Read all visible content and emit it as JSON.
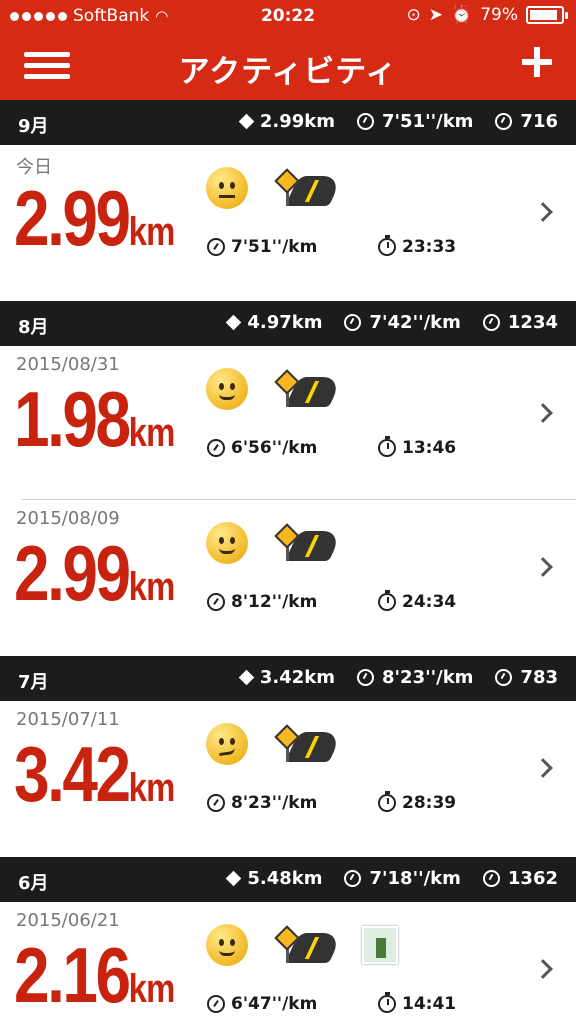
{
  "status_bar": {
    "carrier": "SoftBank",
    "time": "20:22",
    "battery": "79%",
    "battery_level": 0.79
  },
  "nav": {
    "title": "アクティビティ"
  },
  "months": [
    {
      "label": "9月",
      "distance": "2.99km",
      "pace": "7'51''/km",
      "fuel": "716"
    },
    {
      "label": "8月",
      "distance": "4.97km",
      "pace": "7'42''/km",
      "fuel": "1234"
    },
    {
      "label": "7月",
      "distance": "3.42km",
      "pace": "8'23''/km",
      "fuel": "783"
    },
    {
      "label": "6月",
      "distance": "5.48km",
      "pace": "7'18''/km",
      "fuel": "1362"
    }
  ],
  "activities": [
    {
      "date": "今日",
      "distance": "2.99",
      "unit": "km",
      "pace": "7'51''/km",
      "duration": "23:33",
      "mood": "neutral-face-icon"
    },
    {
      "date": "2015/08/31",
      "distance": "1.98",
      "unit": "km",
      "pace": "6'56''/km",
      "duration": "13:46",
      "mood": "smile-face-icon"
    },
    {
      "date": "2015/08/09",
      "distance": "2.99",
      "unit": "km",
      "pace": "8'12''/km",
      "duration": "24:34",
      "mood": "smile-face-icon"
    },
    {
      "date": "2015/07/11",
      "distance": "3.42",
      "unit": "km",
      "pace": "8'23''/km",
      "duration": "28:39",
      "mood": "smirk-face-icon"
    },
    {
      "date": "2015/06/21",
      "distance": "2.16",
      "unit": "km",
      "pace": "6'47''/km",
      "duration": "14:41",
      "mood": "smile-face-icon"
    }
  ],
  "colors": {
    "brand": "#d52b14",
    "distance": "#c8230f",
    "month_bar": "#1c1c1c"
  }
}
